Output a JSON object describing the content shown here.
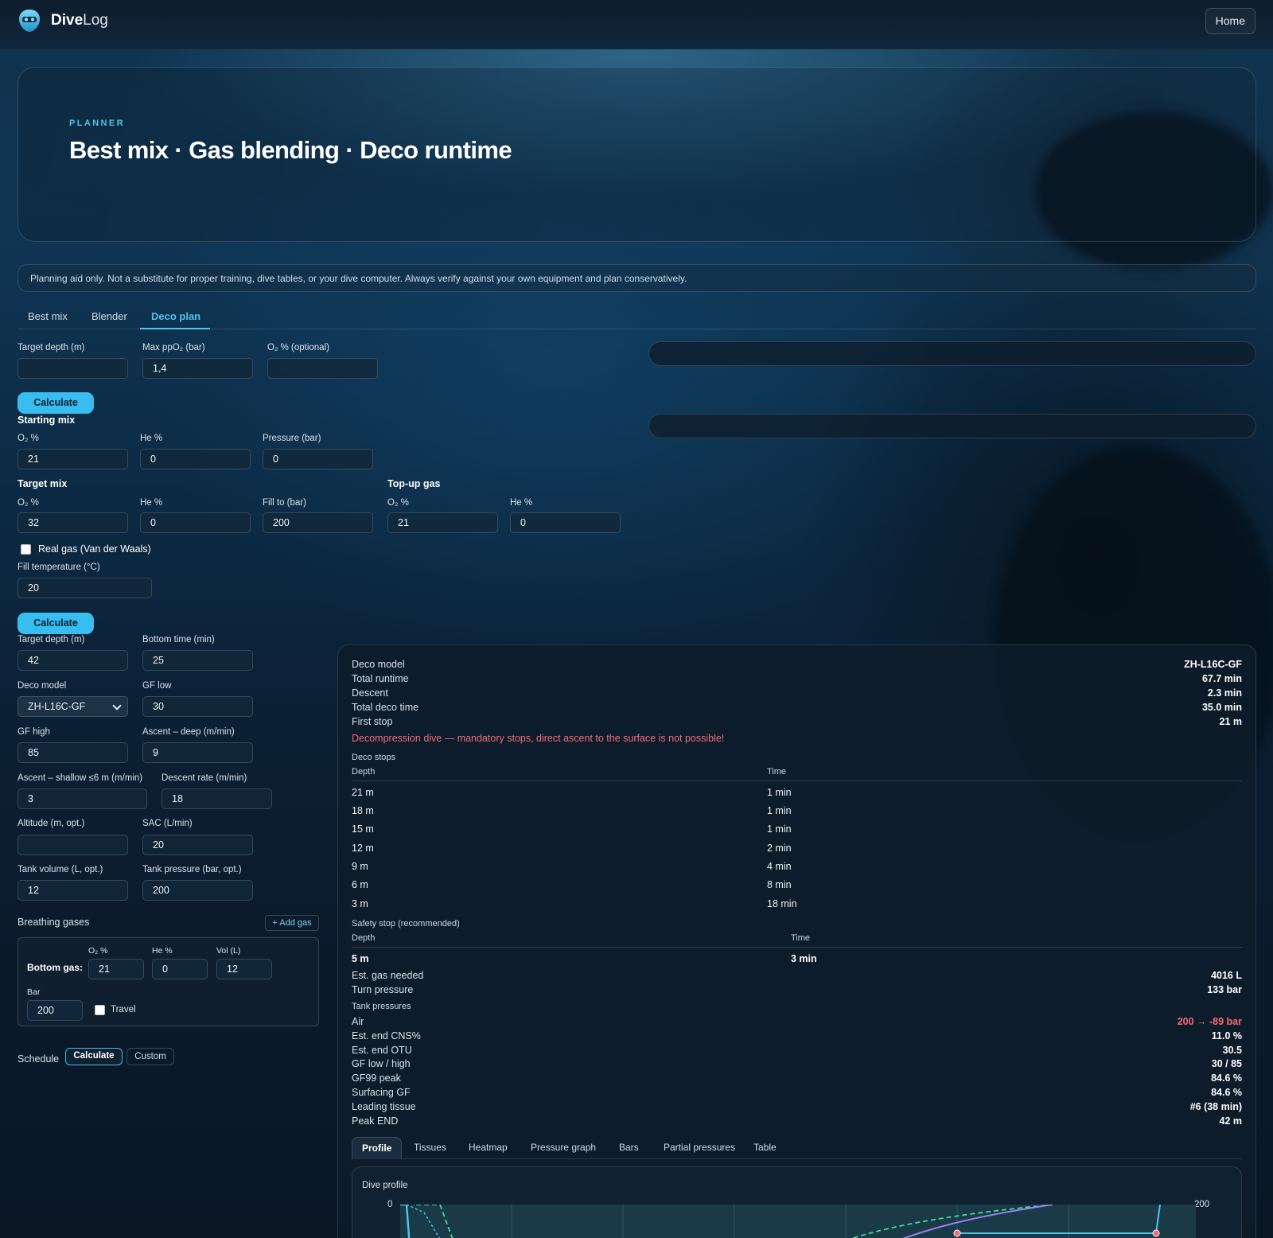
{
  "app": {
    "name_bold": "Dive",
    "name_rest": "Log",
    "home_label": "Home"
  },
  "hero": {
    "eyebrow": "PLANNER",
    "title": "Best mix · Gas blending · Deco runtime"
  },
  "notice": "Planning aid only. Not a substitute for proper training, dive tables, or your dive computer. Always verify against your own equipment and plan conservatively.",
  "tabs": [
    "Best mix",
    "Blender",
    "Deco plan"
  ],
  "active_tab": "Deco plan",
  "best_mix": {
    "target_depth_label": "Target depth (m)",
    "target_depth_value": "",
    "max_ppo2_label": "Max ppO₂ (bar)",
    "max_ppo2_value": "1,4",
    "o2_optional_label": "O₂ % (optional)",
    "o2_optional_value": "",
    "calculate_label": "Calculate"
  },
  "blender": {
    "starting_mix_title": "Starting mix",
    "start_o2_label": "O₂ %",
    "start_o2_value": "21",
    "start_he_label": "He %",
    "start_he_value": "0",
    "start_pressure_label": "Pressure (bar)",
    "start_pressure_value": "0",
    "target_mix_title": "Target mix",
    "target_o2_label": "O₂ %",
    "target_o2_value": "32",
    "target_he_label": "He %",
    "target_he_value": "0",
    "fill_to_label": "Fill to (bar)",
    "fill_to_value": "200",
    "topup_title": "Top-up gas",
    "topup_o2_label": "O₂ %",
    "topup_o2_value": "21",
    "topup_he_label": "He %",
    "topup_he_value": "0",
    "real_gas_label": "Real gas (Van der Waals)",
    "fill_temp_label": "Fill temperature (°C)",
    "fill_temp_value": "20",
    "calculate_label": "Calculate"
  },
  "deco": {
    "target_depth_label": "Target depth (m)",
    "target_depth_value": "42",
    "bottom_time_label": "Bottom time (min)",
    "bottom_time_value": "25",
    "deco_model_label": "Deco model",
    "deco_model_value": "ZH-L16C-GF",
    "gf_low_label": "GF low",
    "gf_low_value": "30",
    "gf_high_label": "GF high",
    "gf_high_value": "85",
    "ascent_deep_label": "Ascent – deep (m/min)",
    "ascent_deep_value": "9",
    "ascent_shallow_label": "Ascent – shallow ≤6 m (m/min)",
    "ascent_shallow_value": "3",
    "descent_rate_label": "Descent rate (m/min)",
    "descent_rate_value": "18",
    "altitude_label": "Altitude (m, opt.)",
    "altitude_value": "",
    "sac_label": "SAC (L/min)",
    "sac_value": "20",
    "tank_volume_label": "Tank volume (L, opt.)",
    "tank_volume_value": "12",
    "tank_pressure_label": "Tank pressure (bar, opt.)",
    "tank_pressure_value": "200",
    "breathing_gases_label": "Breathing gases",
    "add_gas_label": "+ Add gas",
    "gas": {
      "name": "Bottom gas:",
      "o2_label": "O₂ %",
      "o2_value": "21",
      "he_label": "He %",
      "he_value": "0",
      "vol_label": "Vol (L)",
      "vol_value": "12",
      "bar_label": "Bar",
      "bar_value": "200",
      "travel_label": "Travel"
    },
    "schedule_label": "Schedule",
    "schedule_calculate": "Calculate",
    "schedule_custom": "Custom"
  },
  "results": {
    "summary": [
      {
        "k": "Deco model",
        "v": "ZH-L16C-GF"
      },
      {
        "k": "Total runtime",
        "v": "67.7 min"
      },
      {
        "k": "Descent",
        "v": "2.3 min"
      },
      {
        "k": "Total deco time",
        "v": "35.0 min"
      },
      {
        "k": "First stop",
        "v": "21 m"
      }
    ],
    "warning": "Decompression dive — mandatory stops, direct ascent to the surface is not possible!",
    "deco_stops_title": "Deco stops",
    "col_depth": "Depth",
    "col_time": "Time",
    "deco_stops": [
      {
        "depth": "21 m",
        "time": "1 min"
      },
      {
        "depth": "18 m",
        "time": "1 min"
      },
      {
        "depth": "15 m",
        "time": "1 min"
      },
      {
        "depth": "12 m",
        "time": "2 min"
      },
      {
        "depth": "9 m",
        "time": "4 min"
      },
      {
        "depth": "6 m",
        "time": "8 min"
      },
      {
        "depth": "3 m",
        "time": "18 min"
      }
    ],
    "safety_stop_title": "Safety stop (recommended)",
    "safety_stop": {
      "depth": "5 m",
      "time": "3 min"
    },
    "gas_rows": [
      {
        "k": "Est. gas needed",
        "v": "4016 L"
      },
      {
        "k": "Turn pressure",
        "v": "133 bar"
      }
    ],
    "tank_pressures_title": "Tank pressures",
    "tank_rows": [
      {
        "k": "Air",
        "v": "200 → -89 bar"
      },
      {
        "k": "Est. end CNS%",
        "v": "11.0 %"
      },
      {
        "k": "Est. end OTU",
        "v": "30.5"
      },
      {
        "k": "GF low / high",
        "v": "30 / 85"
      },
      {
        "k": "GF99 peak",
        "v": "84.6 %"
      },
      {
        "k": "Surfacing GF",
        "v": "84.6 %"
      },
      {
        "k": "Leading tissue",
        "v": "#6 (38 min)"
      },
      {
        "k": "Peak END",
        "v": "42 m"
      }
    ],
    "subtabs": [
      "Profile",
      "Tissues",
      "Heatmap",
      "Pressure graph",
      "Bars",
      "Partial pressures",
      "Table"
    ],
    "chart_title": "Dive profile",
    "chart_y_top": "0",
    "chart_y2_top": "200"
  },
  "colors": {
    "accent": "#38bdf0",
    "warning": "#f26b73",
    "profile_line": "#4fc3e8",
    "tissue_line": "#9b7ef0",
    "ceiling_line": "#3ddc97"
  }
}
